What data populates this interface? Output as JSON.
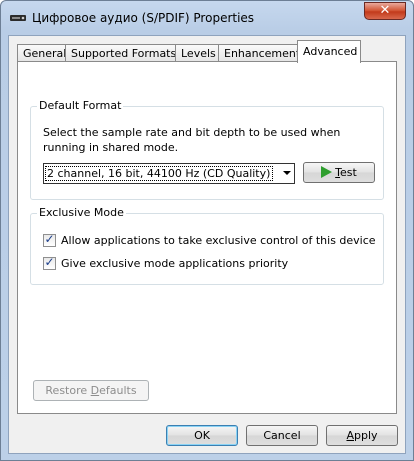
{
  "window": {
    "title": "Цифровое аудио (S/PDIF) Properties",
    "close_glyph": "✕"
  },
  "tabs": [
    {
      "label": "General"
    },
    {
      "label": "Supported Formats"
    },
    {
      "label": "Levels"
    },
    {
      "label": "Enhancements"
    },
    {
      "label": "Advanced",
      "active": true
    }
  ],
  "default_format": {
    "group_label": "Default Format",
    "description": "Select the sample rate and bit depth to be used when running in shared mode.",
    "selected_format": "2 channel, 16 bit, 44100 Hz (CD Quality)",
    "test_button": {
      "accel": "T",
      "rest": "est"
    }
  },
  "exclusive_mode": {
    "group_label": "Exclusive Mode",
    "options": [
      {
        "label": "Allow applications to take exclusive control of this device",
        "checked": true
      },
      {
        "label": "Give exclusive mode applications priority",
        "checked": true
      }
    ]
  },
  "restore_defaults": {
    "before": "Restore ",
    "accel": "D",
    "rest": "efaults"
  },
  "footer": {
    "ok_label": "OK",
    "cancel_label": "Cancel",
    "apply": {
      "accel": "A",
      "rest": "pply"
    }
  },
  "colors": {
    "test_icon": "#2e9e2e",
    "frame": "#bcd0e8",
    "close_button": "#c23a1b"
  }
}
